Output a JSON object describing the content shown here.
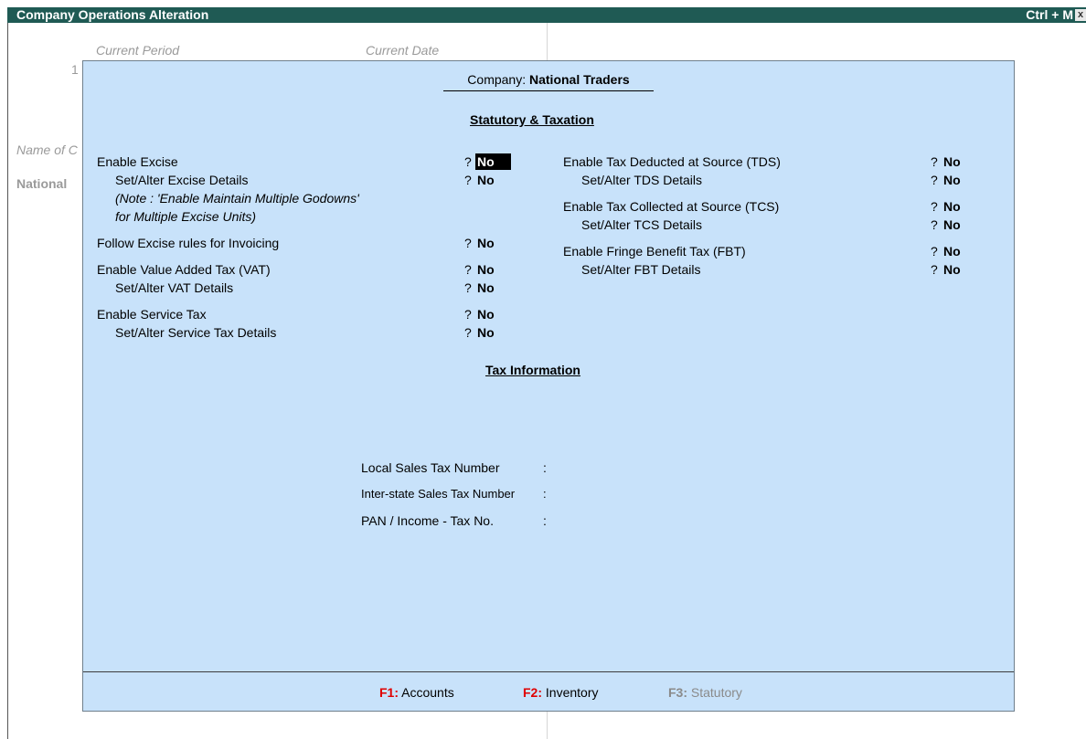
{
  "titlebar": {
    "title": "Company Operations  Alteration",
    "shortcut": "Ctrl + M",
    "close_glyph": "x"
  },
  "background": {
    "current_period_label": "Current Period",
    "current_date_label": "Current Date",
    "period_fragment": "1",
    "name_label_fragment": "Name of C",
    "company_fragment": "National"
  },
  "dialog": {
    "company_label": "Company:",
    "company_name": "National Traders",
    "section1_title": "Statutory & Taxation",
    "section2_title": "Tax Information",
    "left_options": [
      {
        "label": "Enable Excise",
        "value": "No",
        "q": "?"
      },
      {
        "label": "Set/Alter Excise Details",
        "value": "No",
        "q": "?"
      },
      {
        "label": "Follow Excise rules for Invoicing",
        "value": "No",
        "q": "?"
      },
      {
        "label": "Enable Value Added Tax (VAT)",
        "value": "No",
        "q": "?"
      },
      {
        "label": "Set/Alter VAT Details",
        "value": "No",
        "q": "?"
      },
      {
        "label": "Enable Service Tax",
        "value": "No",
        "q": "?"
      },
      {
        "label": "Set/Alter Service Tax Details",
        "value": "No",
        "q": "?"
      }
    ],
    "excise_note_line1": "(Note : 'Enable Maintain Multiple Godowns'",
    "excise_note_line2": "for Multiple Excise Units)",
    "right_options": [
      {
        "label": "Enable Tax Deducted at Source (TDS)",
        "value": "No",
        "q": "?"
      },
      {
        "label": "Set/Alter TDS Details",
        "value": "No",
        "q": "?"
      },
      {
        "label": "Enable Tax Collected at Source (TCS)",
        "value": "No",
        "q": "?"
      },
      {
        "label": "Set/Alter TCS Details",
        "value": "No",
        "q": "?"
      },
      {
        "label": "Enable Fringe Benefit Tax (FBT)",
        "value": "No",
        "q": "?"
      },
      {
        "label": "Set/Alter FBT Details",
        "value": "No",
        "q": "?"
      }
    ],
    "tax_fields": [
      {
        "label": "Local Sales Tax Number",
        "sep": ":"
      },
      {
        "label": "Inter-state Sales Tax Number",
        "sep": ":"
      },
      {
        "label": "PAN / Income - Tax No.",
        "sep": ":"
      }
    ]
  },
  "footer": {
    "f1_key": "F1:",
    "f1_label": "Accounts",
    "f2_key": "F2:",
    "f2_label": "Inventory",
    "f3_key": "F3:",
    "f3_label": "Statutory"
  },
  "colors": {
    "titlebar_bg": "#1f5a54",
    "dialog_bg": "#c8e2fa",
    "fkey_red": "#e00000",
    "disabled_grey": "#8a8a8a"
  }
}
